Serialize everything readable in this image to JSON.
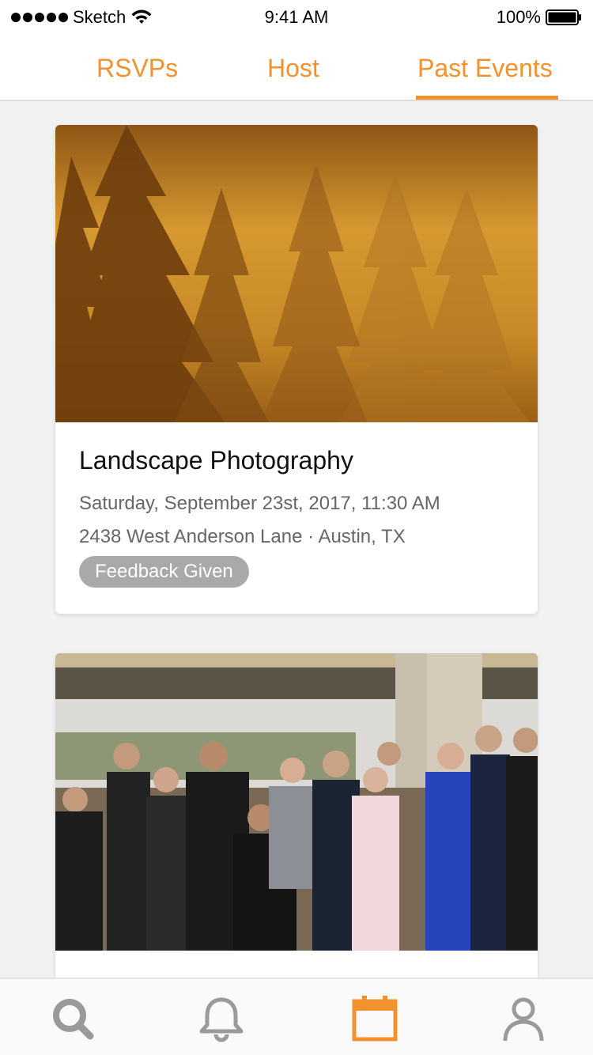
{
  "status_bar": {
    "carrier": "Sketch",
    "time": "9:41 AM",
    "battery": "100%"
  },
  "tabs": [
    {
      "label": "RSVPs"
    },
    {
      "label": "Host"
    },
    {
      "label": "Past Events",
      "active": true
    }
  ],
  "events": [
    {
      "title": "Landscape Photography",
      "date": "Saturday, September 23st, 2017, 11:30 AM",
      "location": "2438 West Anderson Lane · Austin, TX",
      "badge": "Feedback Given",
      "image": "misty-forest-sunrise-photo"
    },
    {
      "title": "",
      "image": "group-of-runners-photo"
    }
  ],
  "bottom_nav": [
    {
      "icon": "search-icon"
    },
    {
      "icon": "bell-icon"
    },
    {
      "icon": "calendar-icon",
      "active": true
    },
    {
      "icon": "profile-icon"
    }
  ],
  "colors": {
    "accent": "#f2922f",
    "badge_bg": "#a9a9a9",
    "inactive_icon": "#9a9a9a"
  }
}
